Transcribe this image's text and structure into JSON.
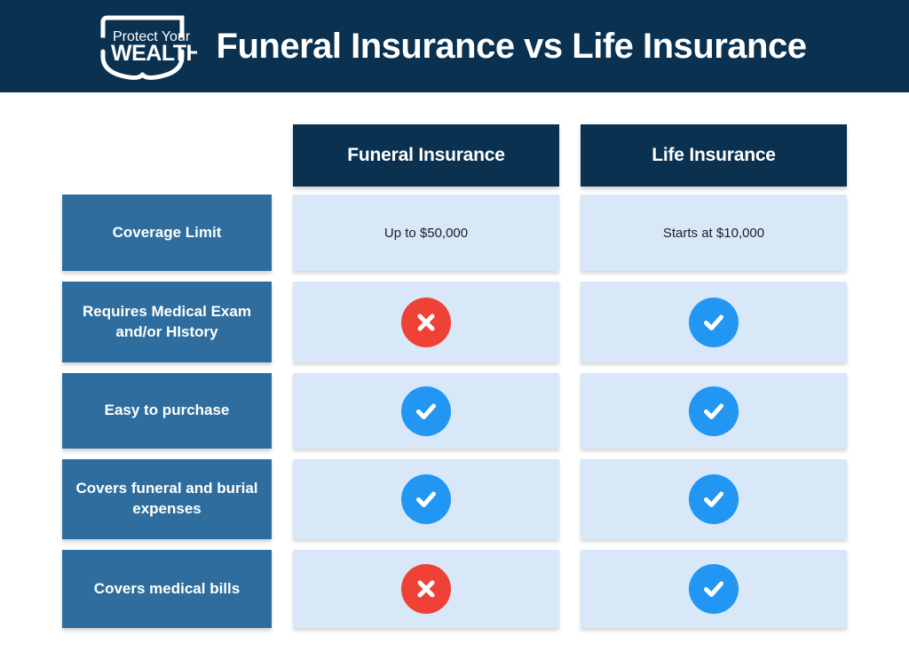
{
  "header": {
    "title": "Funeral Insurance vs Life Insurance",
    "logo": {
      "name": "protect-your-wealth-shield-logo",
      "line1": "Protect Your",
      "line2": "WEALTH"
    },
    "background_color": "#0a3150",
    "text_color": "#ffffff"
  },
  "colors": {
    "navy": "#0a3150",
    "label_blue": "#2e6d9e",
    "cell_light_blue": "#d8e8f8",
    "check_blue": "#2196f3",
    "cross_red": "#ef4136",
    "page_background": "#ffffff"
  },
  "table": {
    "columns": [
      {
        "label": "Funeral Insurance"
      },
      {
        "label": "Life Insurance"
      }
    ],
    "rows": [
      {
        "label": "Coverage Limit",
        "cells": [
          {
            "type": "text",
            "value": "Up to $50,000"
          },
          {
            "type": "text",
            "value": "Starts at $10,000"
          }
        ]
      },
      {
        "label": "Requires Medical Exam and/or HIstory",
        "cells": [
          {
            "type": "icon",
            "icon": "cross-icon",
            "value": "No"
          },
          {
            "type": "icon",
            "icon": "check-icon",
            "value": "Yes"
          }
        ]
      },
      {
        "label": "Easy to purchase",
        "cells": [
          {
            "type": "icon",
            "icon": "check-icon",
            "value": "Yes"
          },
          {
            "type": "icon",
            "icon": "check-icon",
            "value": "Yes"
          }
        ]
      },
      {
        "label": "Covers funeral and burial expenses",
        "cells": [
          {
            "type": "icon",
            "icon": "check-icon",
            "value": "Yes"
          },
          {
            "type": "icon",
            "icon": "check-icon",
            "value": "Yes"
          }
        ]
      },
      {
        "label": "Covers medical bills",
        "cells": [
          {
            "type": "icon",
            "icon": "cross-icon",
            "value": "No"
          },
          {
            "type": "icon",
            "icon": "check-icon",
            "value": "Yes"
          }
        ]
      }
    ]
  }
}
